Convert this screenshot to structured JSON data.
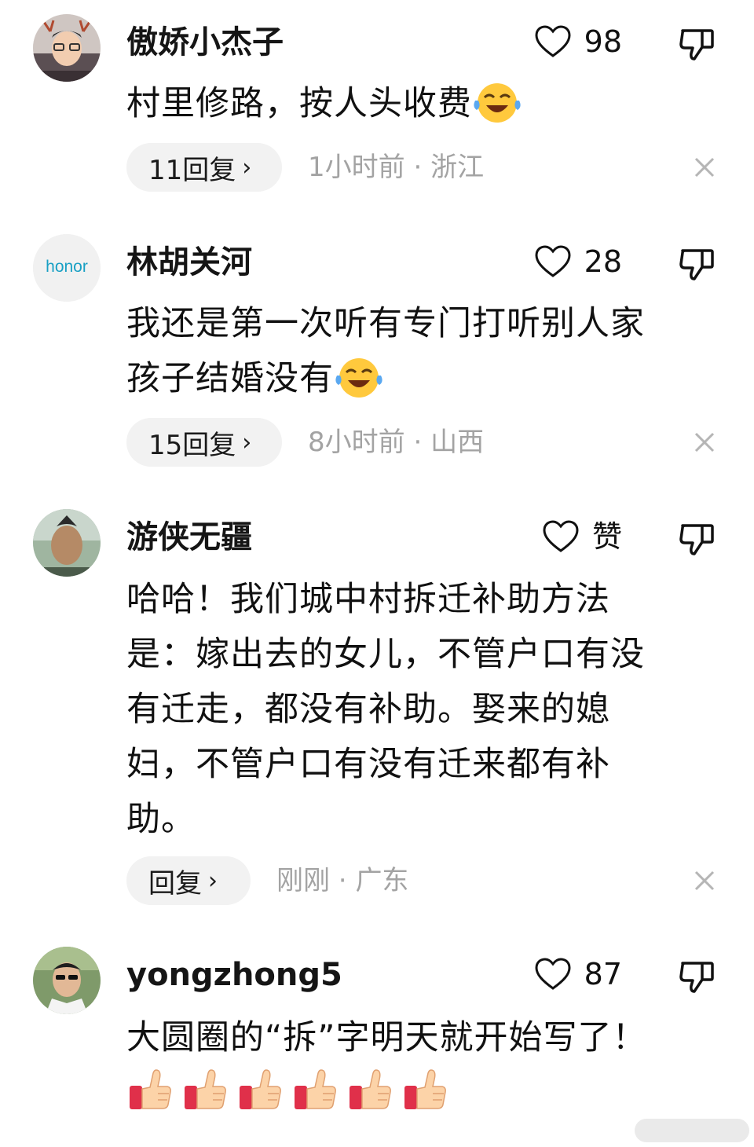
{
  "comments": [
    {
      "username": "傲娇小杰子",
      "likes": "98",
      "text": "村里修路，按人头收费",
      "reply_label": "11回复",
      "time": "1小时前",
      "location": "浙江"
    },
    {
      "username": "林胡关河",
      "avatar_text": "honor",
      "likes": "28",
      "text_line1": "我还是第一次听有专门打听别人家",
      "text_line2": "孩子结婚没有",
      "reply_label": "15回复",
      "time": "8小时前",
      "location": "山西"
    },
    {
      "username": "游侠无疆",
      "likes": "赞",
      "text_lines": [
        "哈哈！我们城中村拆迁补助方法",
        "是：嫁出去的女儿，不管户口有没",
        "有迁走，都没有补助。娶来的媳",
        "妇，不管户口有没有迁来都有补",
        "助。"
      ],
      "reply_label": "回复",
      "time": "刚刚",
      "location": "广东"
    },
    {
      "username": "yongzhong5",
      "likes": "87",
      "text": "大圆圈的“拆”字明天就开始写了！",
      "thumbs_count": 6
    }
  ],
  "separator": " · ",
  "icons": {
    "like": "heart-outline-icon",
    "dislike": "thumbs-down-outline-icon",
    "reply_chevron": "chevron-right-icon",
    "close": "close-icon",
    "emoji": "laughing-crying-emoji",
    "thumb": "thumbs-up-emoji"
  },
  "colors": {
    "meta_text": "#a3a3a3",
    "pill_bg": "#f2f2f2",
    "emoji_yellow": "#ffc93d",
    "emoji_tear": "#5aa8f0"
  }
}
